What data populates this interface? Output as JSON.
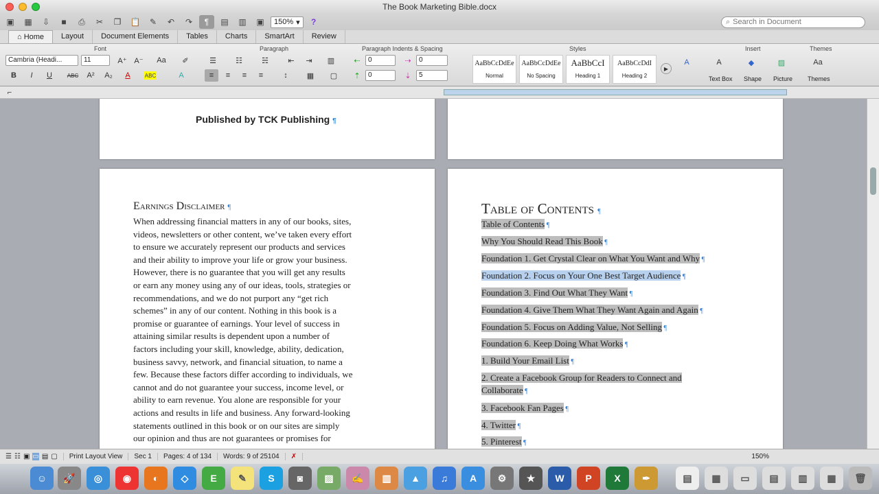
{
  "window": {
    "title": "The Book Marketing Bible.docx"
  },
  "toolbar": {
    "zoom": "150%"
  },
  "search": {
    "placeholder": "Search in Document"
  },
  "ribbon_tabs": [
    "Home",
    "Layout",
    "Document Elements",
    "Tables",
    "Charts",
    "SmartArt",
    "Review"
  ],
  "ribbon": {
    "groups": {
      "font": "Font",
      "paragraph": "Paragraph",
      "indents": "Paragraph Indents & Spacing",
      "styles": "Styles",
      "insert": "Insert",
      "themes": "Themes"
    },
    "font_name": "Cambria (Headi...",
    "font_size": "11",
    "indent_left": "0",
    "indent_right": "0",
    "spacing_before": "0",
    "spacing_after": "5",
    "styles": [
      {
        "preview": "AaBbCcDdEe",
        "name": "Normal"
      },
      {
        "preview": "AaBbCcDdEe",
        "name": "No Spacing"
      },
      {
        "preview": "AaBbCcI",
        "name": "Heading 1"
      },
      {
        "preview": "AaBbCcDdI",
        "name": "Heading 2"
      }
    ],
    "insert_items": [
      "Text Box",
      "Shape",
      "Picture"
    ],
    "themes_item": "Themes",
    "themes_preview": "Aa"
  },
  "document": {
    "page_top_left_text": "Published by TCK Publishing",
    "disclaimer_heading": "Earnings Disclaimer",
    "disclaimer_lines": [
      "When addressing financial matters in any of our books, sites,",
      "videos, newsletters or other content, we’ve taken every effort",
      "to ensure we accurately represent our products and services",
      "and their ability to improve your life or grow your business.",
      "However, there is no guarantee that you will get any results",
      "or earn any money using any of our ideas, tools, strategies or",
      "recommendations, and we do not purport any “get rich",
      "schemes” in any of our content. Nothing in this book is a",
      "promise or guarantee of earnings. Your level of success in",
      "attaining similar results is dependent upon a number of",
      "factors including your skill, knowledge, ability, dedication,",
      "business savvy, network, and financial situation, to name a",
      "few. Because these factors differ according to individuals, we",
      "cannot and do not guarantee your success, income level, or",
      "ability to earn revenue. You alone are responsible for your",
      "actions and results in life and business. Any forward-looking",
      "statements outlined in this book or on our sites are simply",
      "our opinion and thus are not guarantees or promises for"
    ],
    "toc_heading": "Table of Contents",
    "toc_entries": [
      "Table of Contents",
      "Why You Should Read This Book",
      "Foundation 1. Get Crystal Clear on What You Want and Why",
      "Foundation 2. Focus on Your One Best Target Audience",
      "Foundation 3. Find Out What They Want",
      "Foundation 4. Give Them What They Want Again and Again",
      "Foundation 5. Focus on Adding Value, Not Selling",
      "Foundation 6. Keep Doing What Works",
      "1. Build Your Email List",
      "2. Create a Facebook Group for Readers to Connect and",
      "Collaborate",
      "3. Facebook Fan Pages",
      "4. Twitter",
      "5. Pinterest"
    ]
  },
  "status": {
    "view": "Print Layout View",
    "sec_label": "Sec",
    "sec": "1",
    "pages_label": "Pages:",
    "pages": "4 of 134",
    "words_label": "Words:",
    "words": "9 of 25104",
    "zoom": "150%"
  },
  "colors": {
    "selection": "#b7d0ee",
    "toc_highlight": "#bdbdbd",
    "pilcrow": "#3b86d9"
  }
}
